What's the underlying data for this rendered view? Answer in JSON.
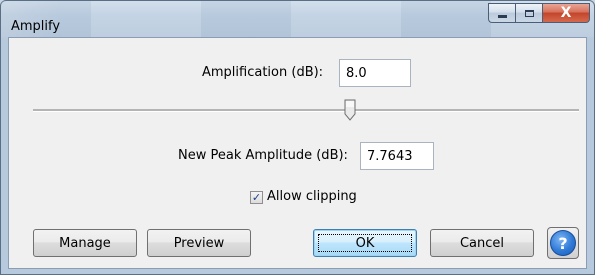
{
  "window": {
    "title": "Amplify",
    "minimize_icon": "minimize-icon",
    "maximize_icon": "maximize-icon",
    "close_icon": "close-icon",
    "close_glyph": "X"
  },
  "amplification": {
    "label": "Amplification (dB):",
    "value": "8.0"
  },
  "slider": {
    "level": 0.58
  },
  "peak": {
    "label": "New Peak Amplitude (dB):",
    "value": "7.7643"
  },
  "clipping": {
    "label": "Allow clipping",
    "checked": true
  },
  "buttons": {
    "manage": "Manage",
    "preview": "Preview",
    "ok": "OK",
    "cancel": "Cancel",
    "help_glyph": "?"
  },
  "colors": {
    "default_button_border": "#3c7fb1",
    "help_blue": "#2f7ad8",
    "close_red": "#c3452b"
  }
}
